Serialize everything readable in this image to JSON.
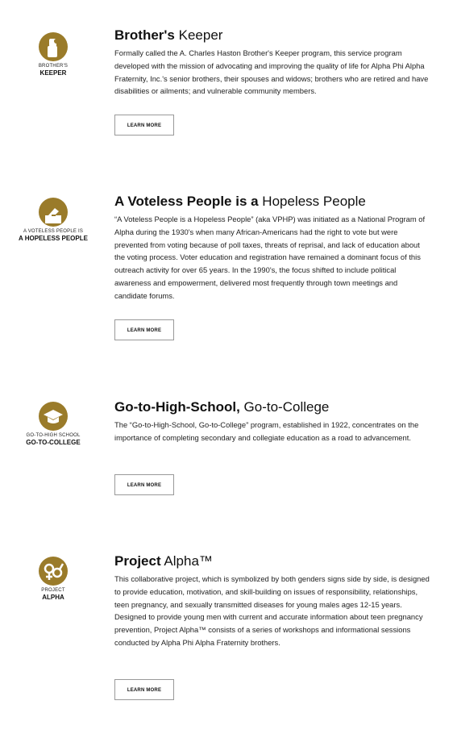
{
  "brand_color": "#9a7b2a",
  "programs": [
    {
      "logo_icon": "raised-fist-icon",
      "logo_line1": "BROTHER'S",
      "logo_line2": "KEEPER",
      "title_bold": "Brother's",
      "title_light": " Keeper",
      "description": "Formally called the A. Charles Haston Brother's Keeper program, this service program developed with the mission of advocating and improving the quality of life for Alpha Phi Alpha Fraternity, Inc.'s senior brothers, their spouses and widows; brothers who are retired and have disabilities or ailments; and vulnerable community members.",
      "button_label": "LEARN MORE"
    },
    {
      "logo_icon": "ballot-hand-icon",
      "logo_line1": "A VOTELESS PEOPLE IS",
      "logo_line2": "A HOPELESS PEOPLE",
      "title_bold": "A Voteless People is a",
      "title_light": " Hopeless People",
      "description": "“A Voteless People is a Hopeless People” (aka VPHP) was initiated as a National Program of Alpha during the 1930's when many African-Americans had the right to vote but were prevented from voting because of poll taxes, threats of reprisal, and lack of education about the voting process. Voter education and registration have remained a dominant focus of this outreach activity for over 65 years. In the 1990's, the focus shifted to include political awareness and empowerment, delivered most frequently through town meetings and candidate forums.",
      "button_label": "LEARN MORE"
    },
    {
      "logo_icon": "graduation-cap-icon",
      "logo_line1": "GO-TO-HIGH SCHOOL",
      "logo_line2": "GO-TO-COLLEGE",
      "title_bold": "Go-to-High-School,",
      "title_light": " Go-to-College",
      "description": "The “Go-to-High-School, Go-to-College” program, established in 1922, concentrates on the importance of completing secondary and collegiate education as a road to advancement.",
      "button_label": "LEARN MORE"
    },
    {
      "logo_icon": "gender-symbols-icon",
      "logo_line1": "PROJECT",
      "logo_line2": "ALPHA",
      "title_bold": "Project",
      "title_light": " Alpha™",
      "description": "This collaborative project, which is symbolized by both genders signs side by side, is designed to provide education, motivation, and skill-building on issues of responsibility, relationships, teen pregnancy, and sexually transmitted diseases for young males ages 12-15 years. Designed to provide young men with current and accurate information about teen pregnancy prevention, Project Alpha™ consists of a series of workshops and informational sessions conducted by Alpha Phi Alpha Fraternity brothers.",
      "button_label": "LEARN MORE"
    }
  ]
}
